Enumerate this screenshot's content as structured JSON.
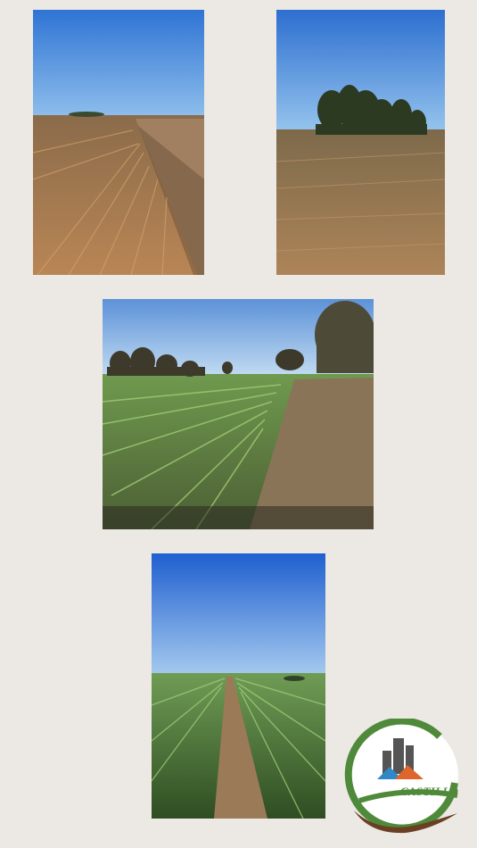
{
  "photos": [
    {
      "id": "harvest-stubble-field"
    },
    {
      "id": "soybean-field-with-trees"
    },
    {
      "id": "sprouting-wheat-rows"
    },
    {
      "id": "corn-field-path"
    }
  ],
  "logo": {
    "text": "CASTILLO",
    "colors": {
      "green": "#4f8a3a",
      "brown": "#6b3f24",
      "orange": "#e0652b",
      "blue": "#2f89c8"
    }
  }
}
